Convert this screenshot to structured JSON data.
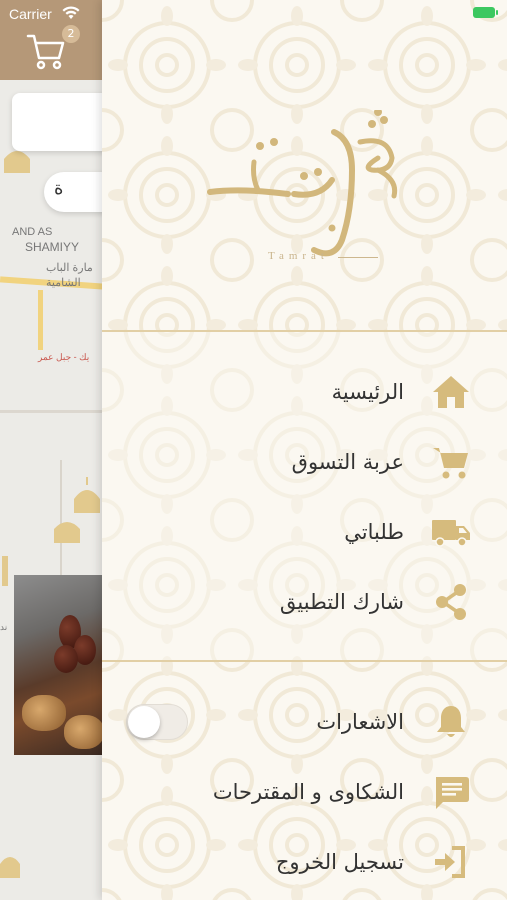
{
  "status": {
    "carrier": "Carrier"
  },
  "cart": {
    "count": "2"
  },
  "background": {
    "search_text": "ة",
    "map_labels": [
      "AND AS",
      "SHAMIYY",
      "مارة الباب",
      "الشامية",
      "يك - جبل عمر",
      "ند"
    ]
  },
  "drawer": {
    "logo": {
      "arabic": "تمرات",
      "latin": "Tamrat"
    },
    "menu": [
      {
        "label": "الرئيسية",
        "icon": "home-icon"
      },
      {
        "label": "عربة التسوق",
        "icon": "cart-icon"
      },
      {
        "label": "طلباتي",
        "icon": "truck-icon"
      },
      {
        "label": "شارك التطبيق",
        "icon": "share-icon"
      }
    ],
    "settings": [
      {
        "label": "الاشعارات",
        "icon": "bell-icon",
        "toggle": false
      },
      {
        "label": "الشكاوى و المقترحات",
        "icon": "message-icon"
      },
      {
        "label": "تسجيل الخروج",
        "icon": "logout-icon"
      }
    ]
  },
  "colors": {
    "accent": "#d6bb7d",
    "header": "#b59878",
    "text": "#333333",
    "battery": "#3cc860"
  }
}
